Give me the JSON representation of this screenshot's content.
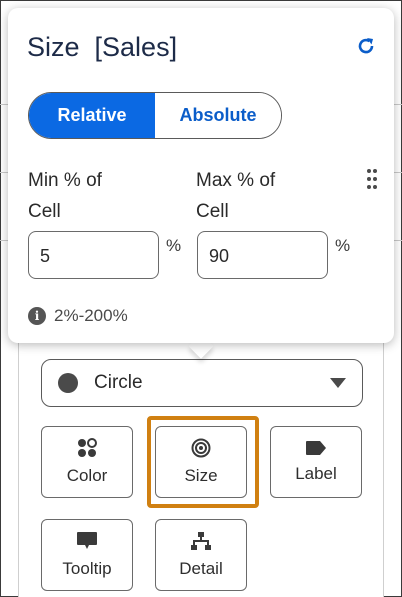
{
  "popover": {
    "title": "Size  [Sales]",
    "toggle": {
      "relative": "Relative",
      "absolute": "Absolute",
      "selected": "Relative"
    },
    "min": {
      "label_line1": "Min % of",
      "label_line2": "Cell",
      "value": "5",
      "unit": "%"
    },
    "max": {
      "label_line1": "Max % of",
      "label_line2": "Cell",
      "value": "90",
      "unit": "%"
    },
    "range_hint": "2%-200%",
    "icons": {
      "refresh": "refresh-icon",
      "drag": "drag-handle-icon",
      "info": "info-icon"
    }
  },
  "marks": {
    "type_select": {
      "value": "Circle"
    },
    "tiles": [
      {
        "label": "Color",
        "icon": "color-icon"
      },
      {
        "label": "Size",
        "icon": "size-icon",
        "highlighted": true
      },
      {
        "label": "Label",
        "icon": "label-icon"
      },
      {
        "label": "Tooltip",
        "icon": "tooltip-icon"
      },
      {
        "label": "Detail",
        "icon": "detail-icon"
      }
    ]
  },
  "colors": {
    "accent": "#0b69e3",
    "highlight": "#d08011",
    "title": "#1d2b48"
  }
}
